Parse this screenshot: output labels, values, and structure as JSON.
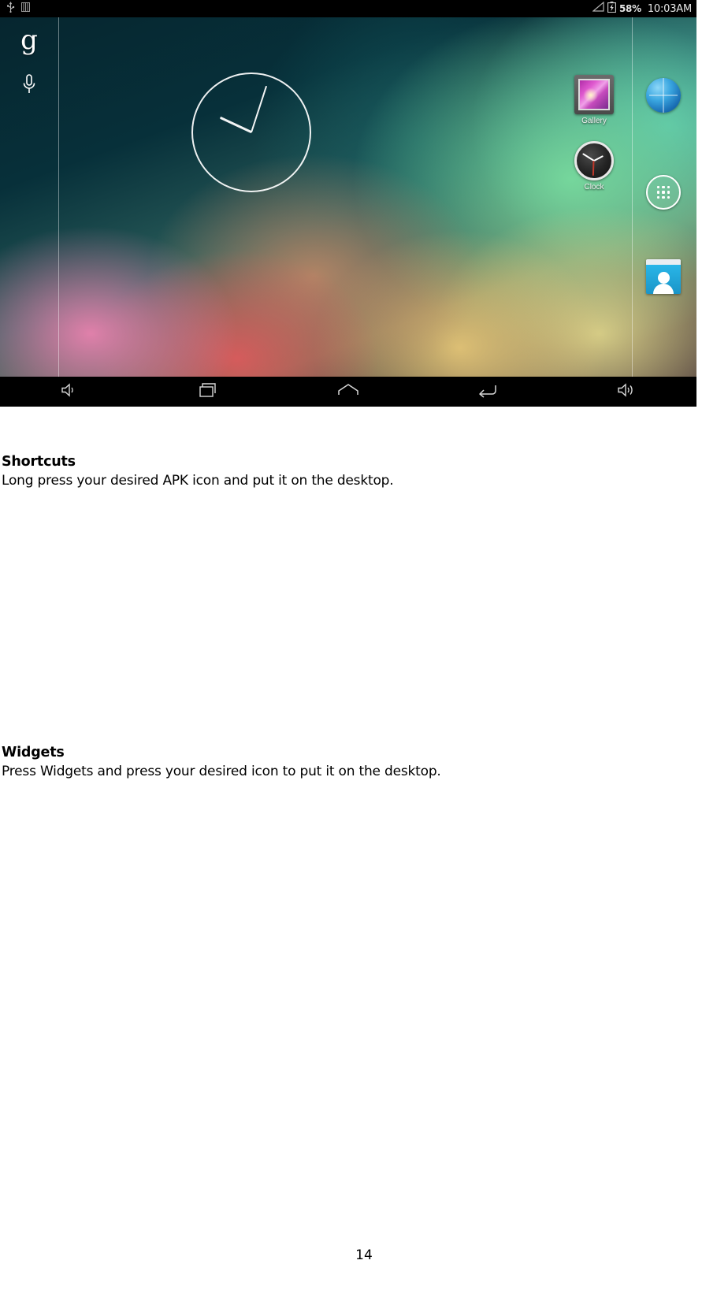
{
  "screenshot": {
    "statusbar": {
      "left_icons": [
        "usb-icon",
        "sim-card-icon"
      ],
      "signal_icon": "signal-triangle-icon",
      "battery_icon": "battery-icon",
      "battery_percent": "58%",
      "clock": "10:03AM"
    },
    "search": {
      "google_logo": "g",
      "mic_icon": "microphone-icon"
    },
    "clock_widget": {
      "name": "analog-clock-widget"
    },
    "desktop_icons": [
      {
        "name": "gallery",
        "label": "Gallery",
        "icon": "gallery-icon"
      },
      {
        "name": "clock",
        "label": "Clock",
        "icon": "clock-icon"
      }
    ],
    "dock_icons": [
      {
        "name": "browser",
        "icon": "browser-globe-icon"
      },
      {
        "name": "app-drawer",
        "icon": "app-drawer-icon"
      },
      {
        "name": "contacts",
        "icon": "contacts-icon"
      }
    ],
    "navbar": [
      {
        "name": "volume-down",
        "icon": "volume-down-icon"
      },
      {
        "name": "recents",
        "icon": "recent-apps-icon"
      },
      {
        "name": "home",
        "icon": "home-icon"
      },
      {
        "name": "back",
        "icon": "back-arrow-icon"
      },
      {
        "name": "volume-up",
        "icon": "volume-up-icon"
      }
    ]
  },
  "doc": {
    "sections": [
      {
        "heading": "Shortcuts",
        "body": "Long press your desired APK icon and put it on the desktop."
      },
      {
        "heading": "Widgets",
        "body": "Press Widgets and press your desired icon to put it on the desktop."
      }
    ],
    "page_number": "14"
  }
}
